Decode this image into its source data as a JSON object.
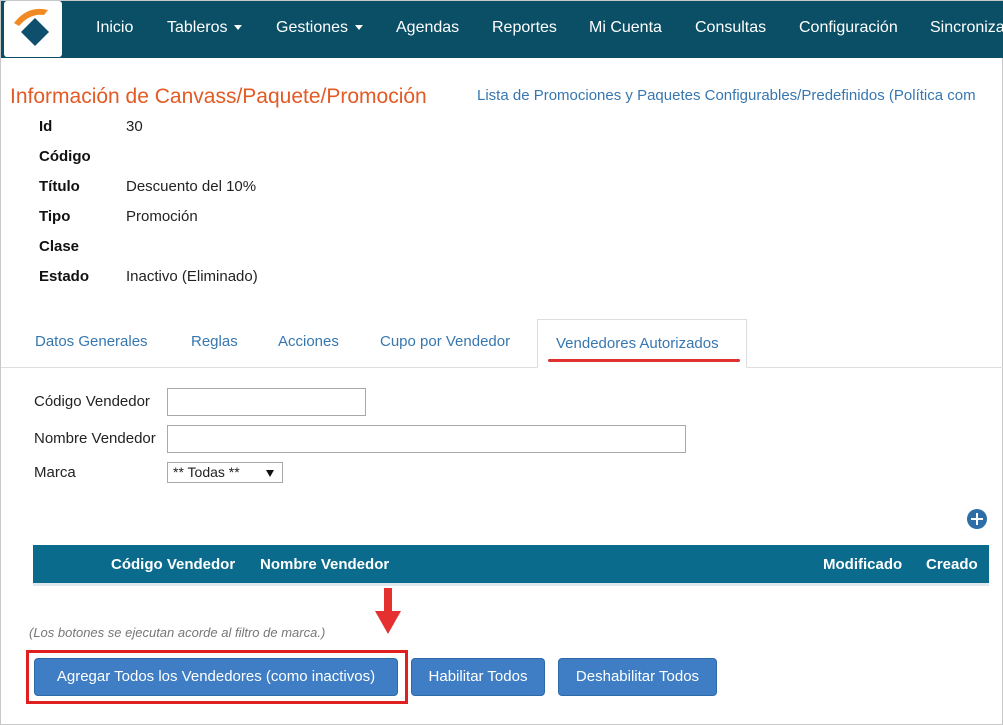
{
  "navbar": {
    "items": [
      {
        "label": "Inicio",
        "has_caret": false
      },
      {
        "label": "Tableros",
        "has_caret": true
      },
      {
        "label": "Gestiones",
        "has_caret": true
      },
      {
        "label": "Agendas",
        "has_caret": false
      },
      {
        "label": "Reportes",
        "has_caret": false
      },
      {
        "label": "Mi Cuenta",
        "has_caret": false
      },
      {
        "label": "Consultas",
        "has_caret": false
      },
      {
        "label": "Configuración",
        "has_caret": false
      },
      {
        "label": "Sincroniza",
        "has_caret": false
      }
    ],
    "background": "#0a4f66"
  },
  "header": {
    "title": "Información de Canvass/Paquete/Promoción",
    "list_link": "Lista de Promociones y Paquetes Configurables/Predefinidos (Política com",
    "title_color": "#e35a24",
    "link_color": "#3777b0"
  },
  "info": [
    {
      "label": "Id",
      "value": "30"
    },
    {
      "label": "Código",
      "value": ""
    },
    {
      "label": "Título",
      "value": "Descuento del 10%"
    },
    {
      "label": "Tipo",
      "value": "Promoción"
    },
    {
      "label": "Clase",
      "value": ""
    },
    {
      "label": "Estado",
      "value": "Inactivo (Eliminado)"
    }
  ],
  "tabs": [
    {
      "label": "Datos Generales",
      "active": false
    },
    {
      "label": "Reglas",
      "active": false
    },
    {
      "label": "Acciones",
      "active": false
    },
    {
      "label": "Cupo por Vendedor",
      "active": false
    },
    {
      "label": "Vendedores Autorizados",
      "active": true
    }
  ],
  "filters": {
    "codigo_label": "Código Vendedor",
    "codigo_value": "",
    "nombre_label": "Nombre Vendedor",
    "nombre_value": "",
    "marca_label": "Marca",
    "marca_selected": "** Todas **"
  },
  "add_icon": "plus-circle-icon",
  "table": {
    "columns": [
      "Código Vendedor",
      "Nombre Vendedor",
      "Modificado",
      "Creado"
    ],
    "header_color": "#0b6b8c"
  },
  "note": "(Los botones se ejecutan acorde al filtro de marca.)",
  "buttons": {
    "add_all": "Agregar Todos los Vendedores (como inactivos)",
    "enable_all": "Habilitar Todos",
    "disable_all": "Deshabilitar Todos",
    "color": "#3f7ec4"
  },
  "annotation": {
    "arrow_icon": "down-arrow-icon",
    "highlight_color": "#e02020"
  }
}
